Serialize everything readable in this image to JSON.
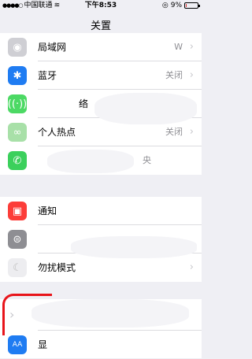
{
  "status_bar": {
    "carrier": "中国联通",
    "time": "下午8:53",
    "battery": "9%",
    "battery_level": 0.09
  },
  "nav": {
    "title": "关置"
  },
  "group1": [
    {
      "icon": "wifi-icon",
      "label": "局域网",
      "value": "W",
      "color": "#cfcfd4"
    },
    {
      "icon": "bluetooth-icon",
      "label": "蓝牙",
      "value": "关闭",
      "color": "#1f7cf2"
    },
    {
      "icon": "cellular-icon",
      "label": "络",
      "value": "",
      "color": "#4cd964"
    },
    {
      "icon": "hotspot-icon",
      "label": "个人热点",
      "value": "关闭",
      "color": "#a8e0a8"
    },
    {
      "icon": "phone-icon",
      "label": "",
      "value": "央",
      "color": "#3bd05c"
    }
  ],
  "group2": [
    {
      "icon": "notification-icon",
      "label": "通知",
      "value": "",
      "color": "#fc3d39"
    },
    {
      "icon": "control-center-icon",
      "label": "",
      "value": "",
      "color": "#8e8e93"
    },
    {
      "icon": "moon-icon",
      "label": "勿扰模式",
      "value": "",
      "color": "#e8e8ec"
    }
  ],
  "group3": [
    {
      "icon": "gear-icon",
      "label": "",
      "value": "",
      "color": "#ffffff"
    },
    {
      "icon": "display-icon",
      "label": "显",
      "value": "",
      "color": "#1f7cf2"
    }
  ]
}
